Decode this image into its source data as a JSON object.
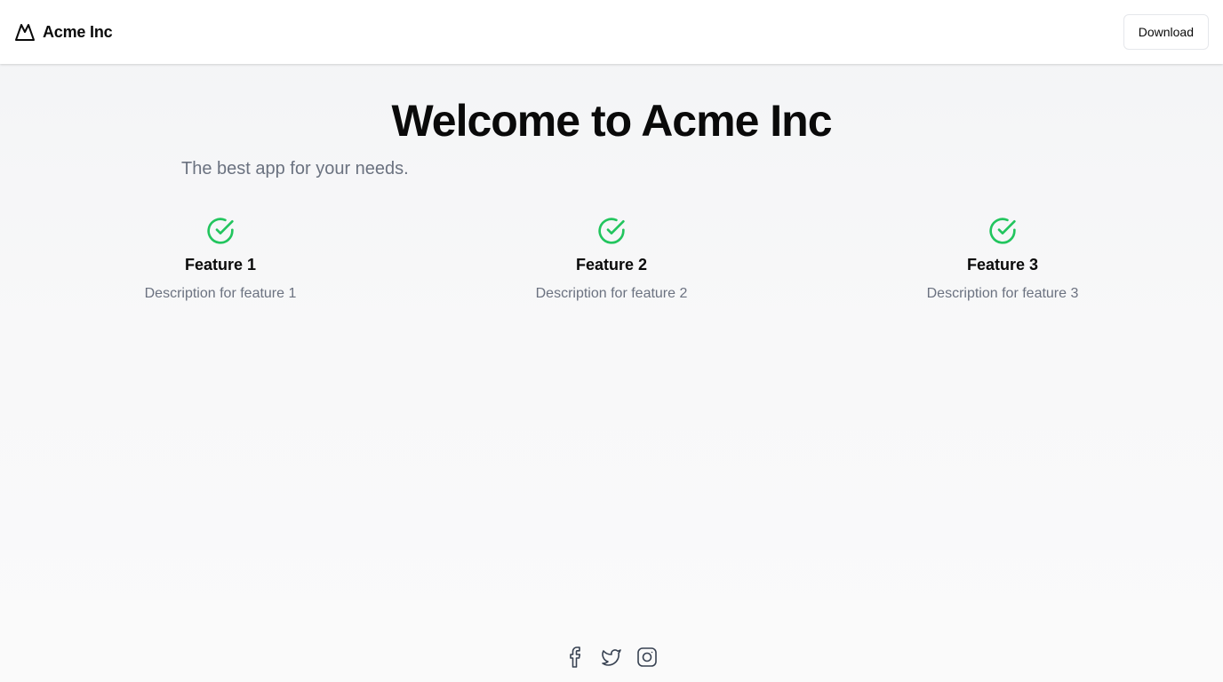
{
  "header": {
    "brand_name": "Acme Inc",
    "brand_icon": "mountain-icon",
    "download_label": "Download"
  },
  "hero": {
    "title": "Welcome to Acme Inc",
    "subtitle": "The best app for your needs."
  },
  "features": [
    {
      "icon": "check-circle-icon",
      "title": "Feature 1",
      "description": "Description for feature 1"
    },
    {
      "icon": "check-circle-icon",
      "title": "Feature 2",
      "description": "Description for feature 2"
    },
    {
      "icon": "check-circle-icon",
      "title": "Feature 3",
      "description": "Description for feature 3"
    }
  ],
  "footer": {
    "social": [
      "facebook-icon",
      "twitter-icon",
      "instagram-icon"
    ]
  },
  "colors": {
    "accent_green": "#22c55e",
    "muted_text": "#6b7280",
    "background": "#f3f4f6",
    "text": "#0a0a0a"
  }
}
